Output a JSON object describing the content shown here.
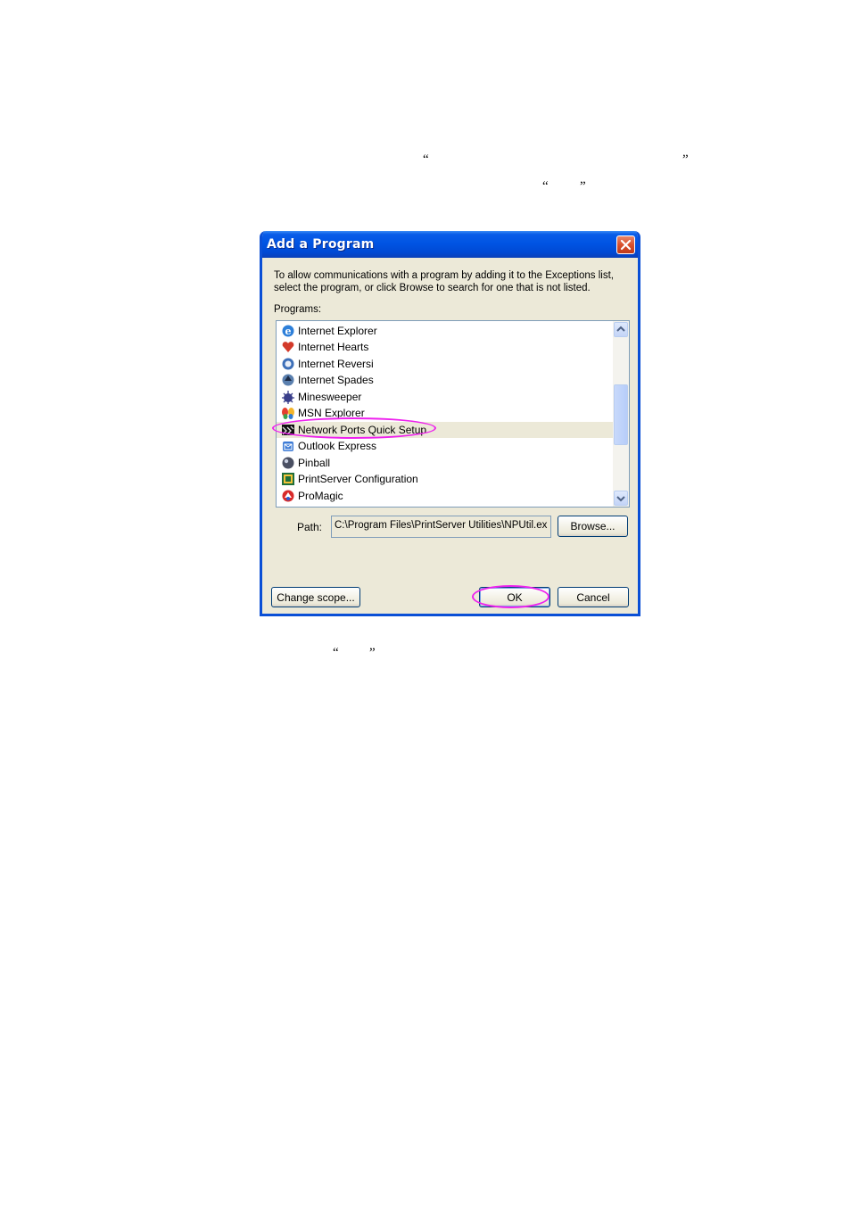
{
  "document": {
    "quote_line1_open": "“",
    "quote_line1_close": "”",
    "quote_line2_open": "“",
    "quote_line2_close": "”",
    "quote_line3_open": "“",
    "quote_line3_close": "”"
  },
  "dialog": {
    "title": "Add a Program",
    "description_line1": "To allow communications with a program by adding it to the Exceptions list,",
    "description_line2": "select the program, or click Browse to search for one that is not listed.",
    "programs_label": "Programs:",
    "programs": [
      {
        "label": "Internet Explorer",
        "icon": "internet-explorer-icon",
        "selected": false
      },
      {
        "label": "Internet Hearts",
        "icon": "hearts-icon",
        "selected": false
      },
      {
        "label": "Internet Reversi",
        "icon": "reversi-icon",
        "selected": false
      },
      {
        "label": "Internet Spades",
        "icon": "spades-icon",
        "selected": false
      },
      {
        "label": "Minesweeper",
        "icon": "minesweeper-icon",
        "selected": false
      },
      {
        "label": "MSN Explorer",
        "icon": "msn-butterfly-icon",
        "selected": false
      },
      {
        "label": "Network Ports Quick Setup",
        "icon": "network-ports-icon",
        "selected": true
      },
      {
        "label": "Outlook Express",
        "icon": "outlook-express-icon",
        "selected": false
      },
      {
        "label": "Pinball",
        "icon": "pinball-icon",
        "selected": false
      },
      {
        "label": "PrintServer Configuration",
        "icon": "printserver-icon",
        "selected": false
      },
      {
        "label": "ProMagic",
        "icon": "promagic-icon",
        "selected": false
      }
    ],
    "path_label": "Path:",
    "path_value": "C:\\Program Files\\PrintServer Utilities\\NPUtil.ex",
    "browse_button": "Browse...",
    "change_scope_button": "Change scope...",
    "ok_button": "OK",
    "cancel_button": "Cancel"
  },
  "colors": {
    "highlight_oval": "#ee22ee",
    "title_bar": "#0054e3",
    "dialog_face": "#ece9d8"
  }
}
